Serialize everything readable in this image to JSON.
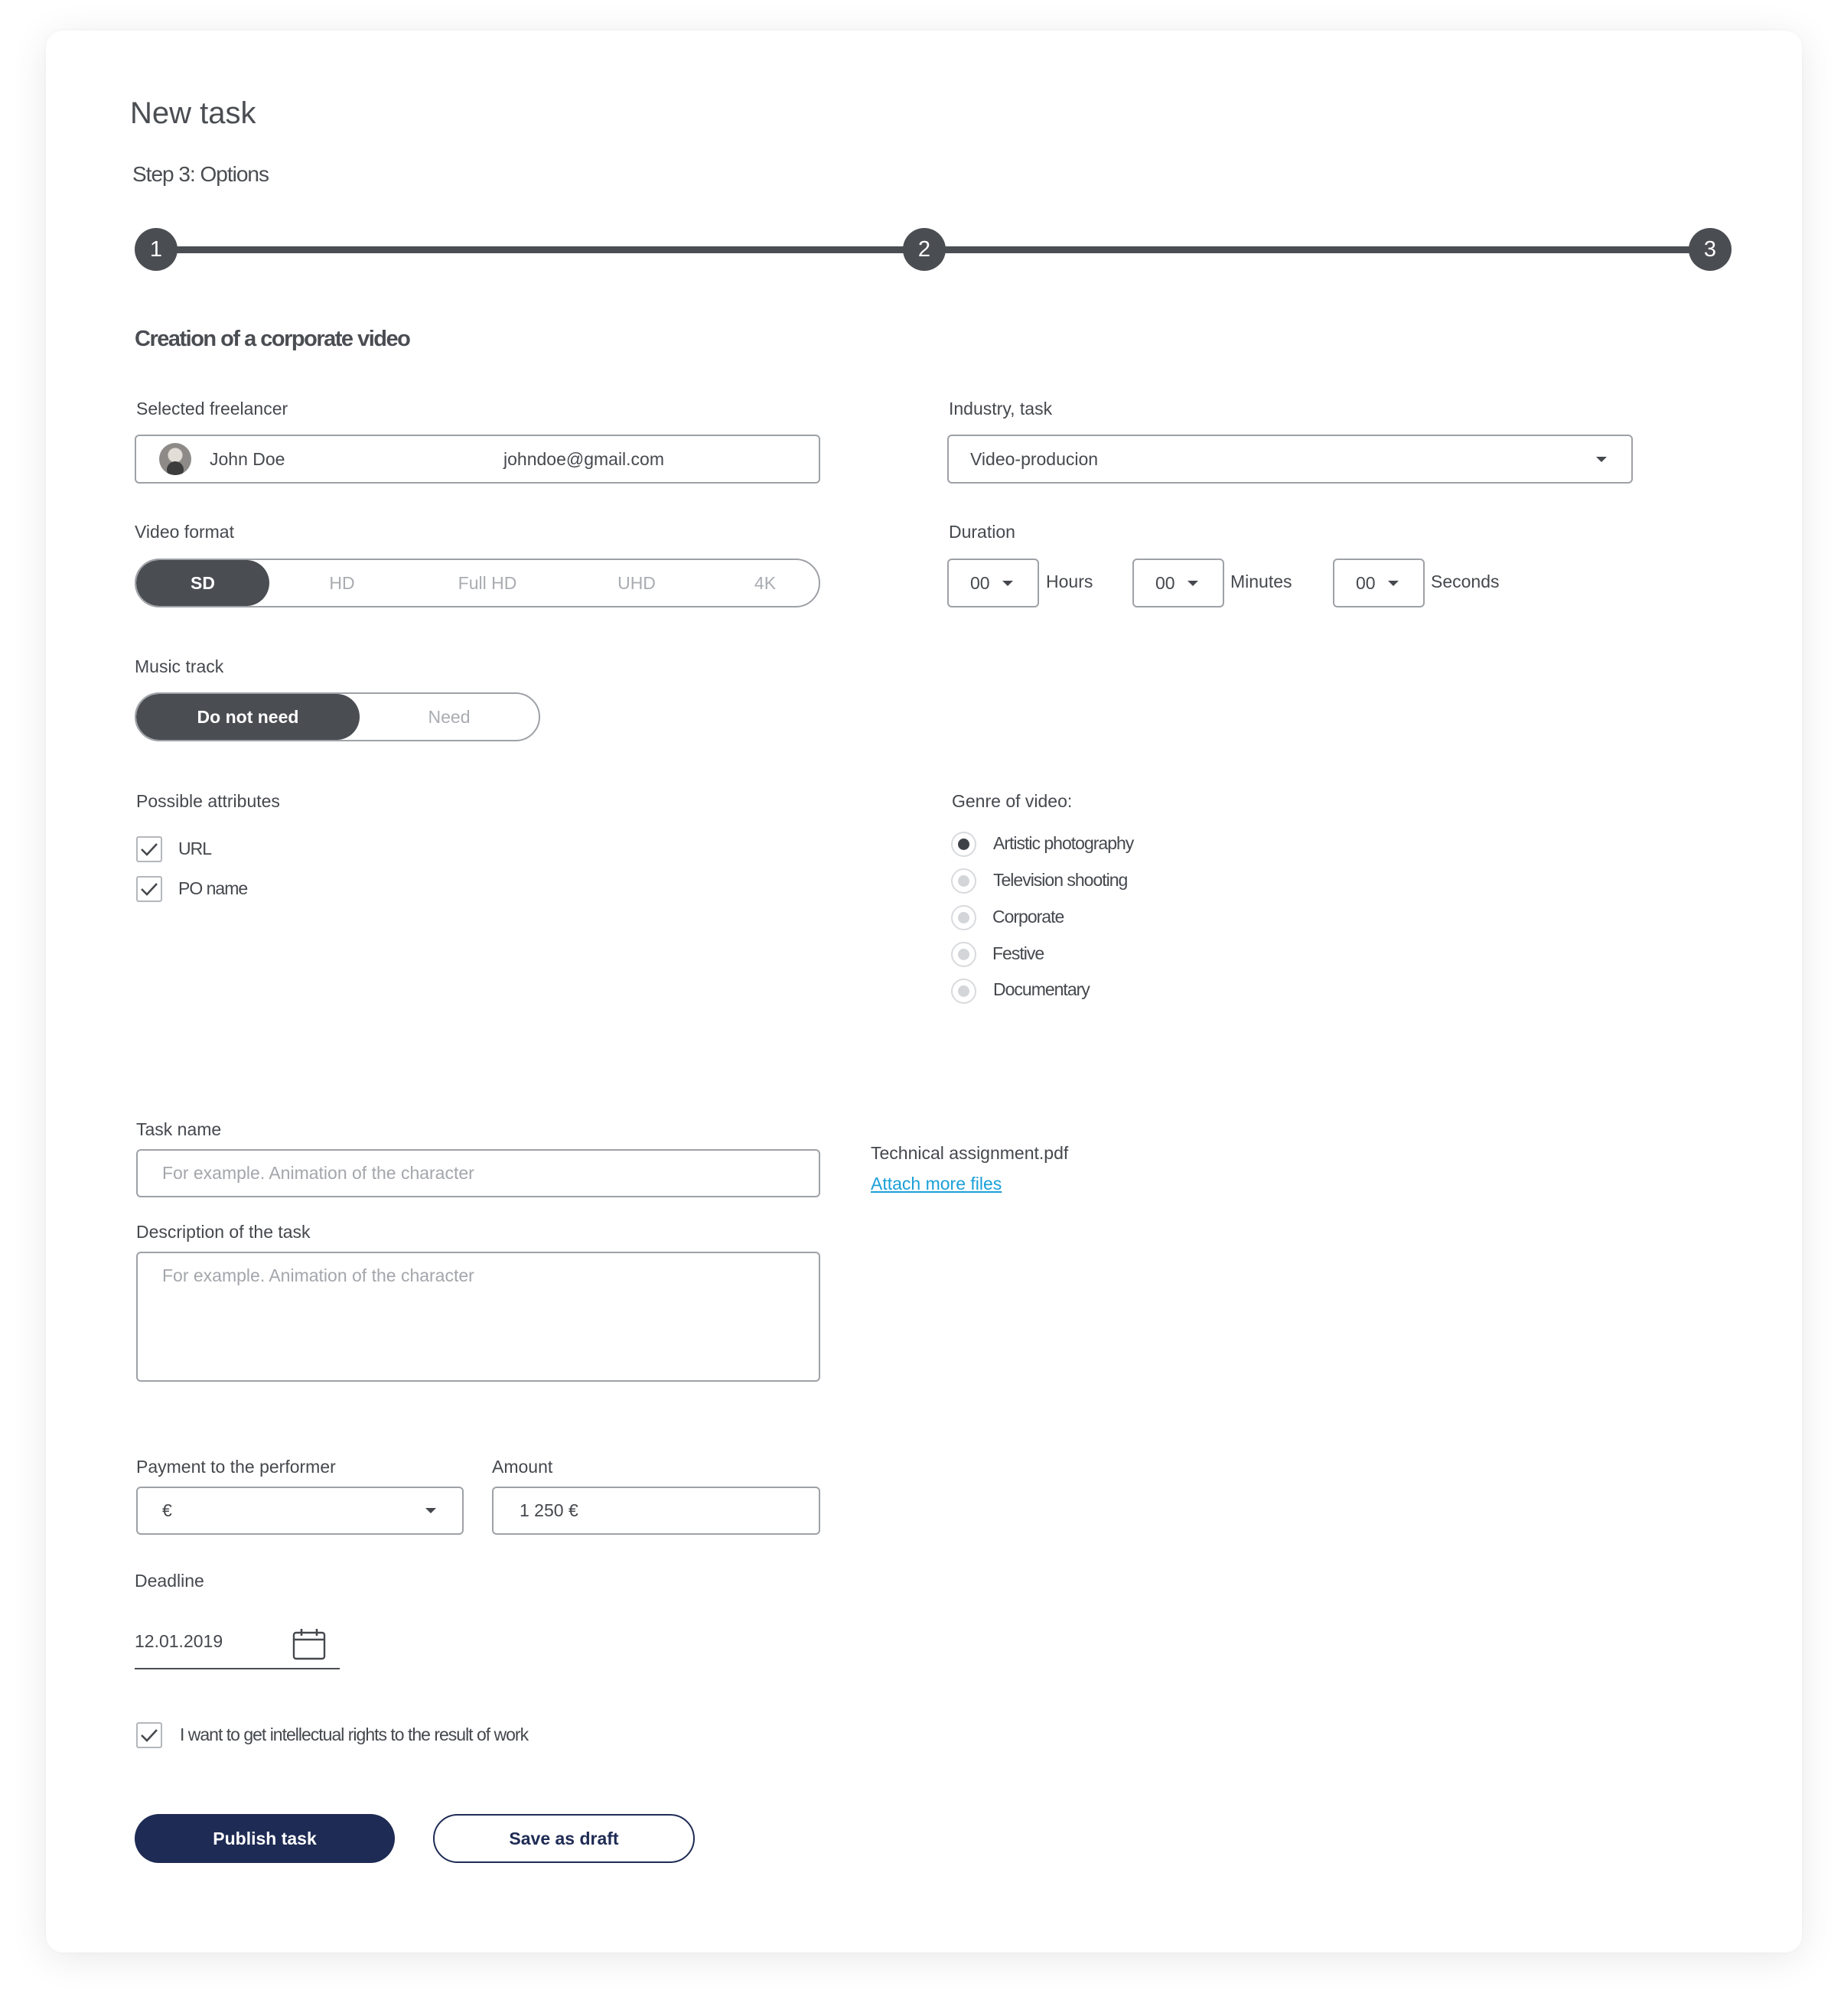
{
  "page": {
    "title": "New task",
    "subtitle": "Step 3: Options"
  },
  "stepper": {
    "steps": [
      "1",
      "2",
      "3"
    ],
    "current": 3
  },
  "section_title": "Creation of a corporate video",
  "freelancer": {
    "label": "Selected freelancer",
    "name": "John Doe",
    "email": "johndoe@gmail.com"
  },
  "industry": {
    "label": "Industry, task",
    "value": "Video-producion"
  },
  "video_format": {
    "label": "Video format",
    "options": [
      "SD",
      "HD",
      "Full HD",
      "UHD",
      "4K"
    ],
    "selected": "SD"
  },
  "duration": {
    "label": "Duration",
    "hours_value": "00",
    "hours_label": "Hours",
    "minutes_value": "00",
    "minutes_label": "Minutes",
    "seconds_value": "00",
    "seconds_label": "Seconds"
  },
  "music_track": {
    "label": "Music track",
    "options": [
      "Do not need",
      "Need"
    ],
    "selected": "Do not need"
  },
  "attributes": {
    "label": "Possible attributes",
    "items": [
      {
        "label": "URL",
        "checked": true
      },
      {
        "label": "PO name",
        "checked": true
      }
    ]
  },
  "genre": {
    "label": "Genre of video:",
    "options": [
      "Artistic photography",
      "Television shooting",
      "Corporate",
      "Festive",
      "Documentary"
    ],
    "selected": "Artistic photography"
  },
  "task_name": {
    "label": "Task name",
    "placeholder": "For example. Animation of the character"
  },
  "description": {
    "label": "Description of the task",
    "placeholder": "For example. Animation of the character"
  },
  "files": {
    "file_name": "Technical assignment.pdf",
    "attach_link": "Attach more files"
  },
  "payment": {
    "label": "Payment to the performer",
    "value": "€"
  },
  "amount": {
    "label": "Amount",
    "value": "1 250 €"
  },
  "deadline": {
    "label": "Deadline",
    "value": "12.01.2019"
  },
  "rights": {
    "label": "I want to get intellectual rights to the result of work",
    "checked": true
  },
  "actions": {
    "publish": "Publish task",
    "draft": "Save as draft"
  },
  "colors": {
    "primary": "#1e2b54",
    "dark": "#4a4d52",
    "link": "#1aa0d8",
    "border": "#9ea1a6"
  }
}
